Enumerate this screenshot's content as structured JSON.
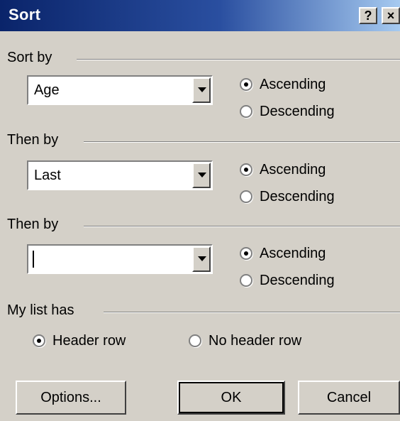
{
  "window": {
    "title": "Sort",
    "help_glyph": "?",
    "close_glyph": "×"
  },
  "sort_by": {
    "label": "Sort by",
    "field_value": "Age",
    "ascending_label": "Ascending",
    "descending_label": "Descending",
    "selected": "ascending"
  },
  "then_by_1": {
    "label": "Then by",
    "field_value": "Last",
    "ascending_label": "Ascending",
    "descending_label": "Descending",
    "selected": "ascending"
  },
  "then_by_2": {
    "label": "Then by",
    "field_value": "",
    "ascending_label": "Ascending",
    "descending_label": "Descending",
    "selected": "ascending"
  },
  "list_has": {
    "label": "My list has",
    "header_row_label": "Header row",
    "no_header_row_label": "No header row",
    "selected": "header_row"
  },
  "buttons": {
    "options_label": "Options...",
    "ok_label": "OK",
    "cancel_label": "Cancel"
  }
}
